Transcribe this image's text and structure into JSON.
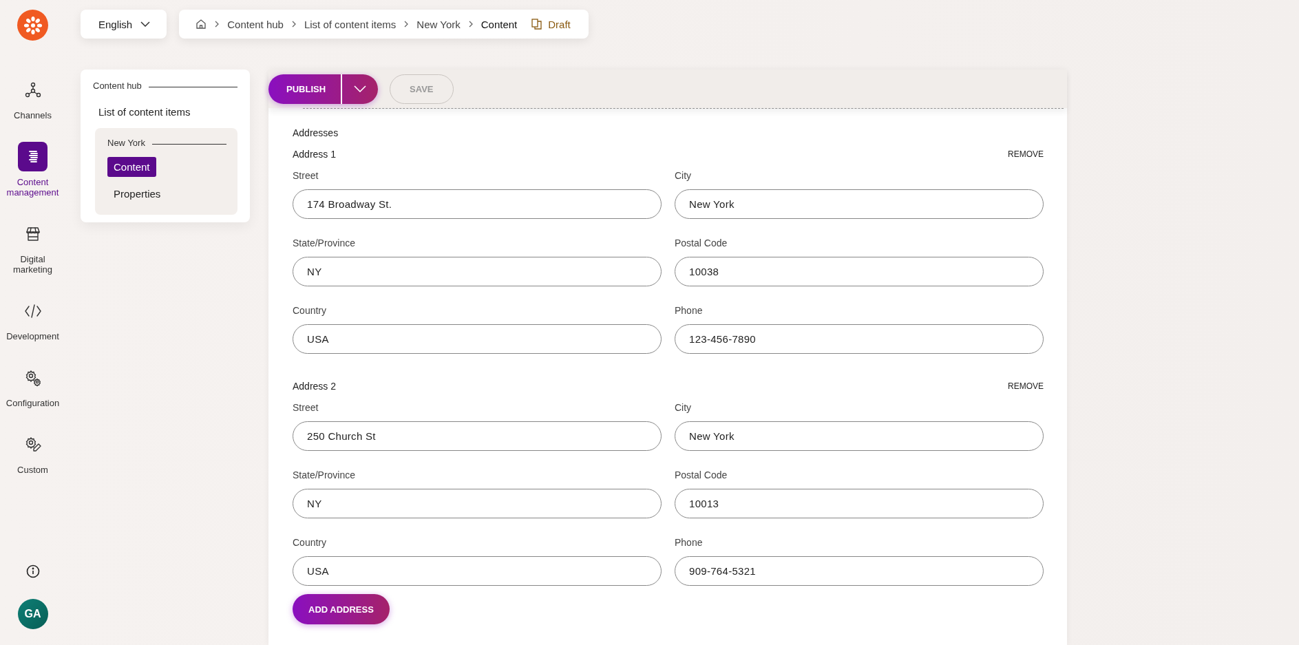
{
  "language": {
    "label": "English"
  },
  "breadcrumb": {
    "items": [
      {
        "label": "Content hub"
      },
      {
        "label": "List of content items"
      },
      {
        "label": "New York"
      },
      {
        "label": "Content"
      }
    ],
    "status": "Draft"
  },
  "nav": {
    "items": [
      {
        "kind": "channels",
        "label": "Channels",
        "selected": false
      },
      {
        "kind": "content",
        "label": "Content management",
        "selected": true
      },
      {
        "kind": "marketing",
        "label": "Digital marketing",
        "selected": false
      },
      {
        "kind": "development",
        "label": "Development",
        "selected": false
      },
      {
        "kind": "configuration",
        "label": "Configuration",
        "selected": false
      },
      {
        "kind": "custom",
        "label": "Custom",
        "selected": false
      }
    ],
    "avatar": "GA"
  },
  "tree": {
    "title": "Content hub",
    "list_item": "List of content items",
    "group": "New York",
    "items": [
      {
        "label": "Content",
        "selected": true
      },
      {
        "label": "Properties",
        "selected": false
      }
    ]
  },
  "toolbar": {
    "publish": "PUBLISH",
    "save": "SAVE",
    "save_disabled": true
  },
  "form": {
    "section_title": "Addresses",
    "add_button": "ADD ADDRESS",
    "addresses": [
      {
        "title": "Address 1",
        "remove_label": "REMOVE",
        "fields": [
          {
            "label": "Street",
            "value": "174 Broadway St."
          },
          {
            "label": "City",
            "value": "New York"
          },
          {
            "label": "State/Province",
            "value": "NY"
          },
          {
            "label": "Postal Code",
            "value": "10038"
          },
          {
            "label": "Country",
            "value": "USA"
          },
          {
            "label": "Phone",
            "value": "123-456-7890"
          }
        ]
      },
      {
        "title": "Address 2",
        "remove_label": "REMOVE",
        "fields": [
          {
            "label": "Street",
            "value": "250 Church St"
          },
          {
            "label": "City",
            "value": "New York"
          },
          {
            "label": "State/Province",
            "value": "NY"
          },
          {
            "label": "Postal Code",
            "value": "10013"
          },
          {
            "label": "Country",
            "value": "USA"
          },
          {
            "label": "Phone",
            "value": "909-764-5321"
          }
        ]
      }
    ]
  }
}
